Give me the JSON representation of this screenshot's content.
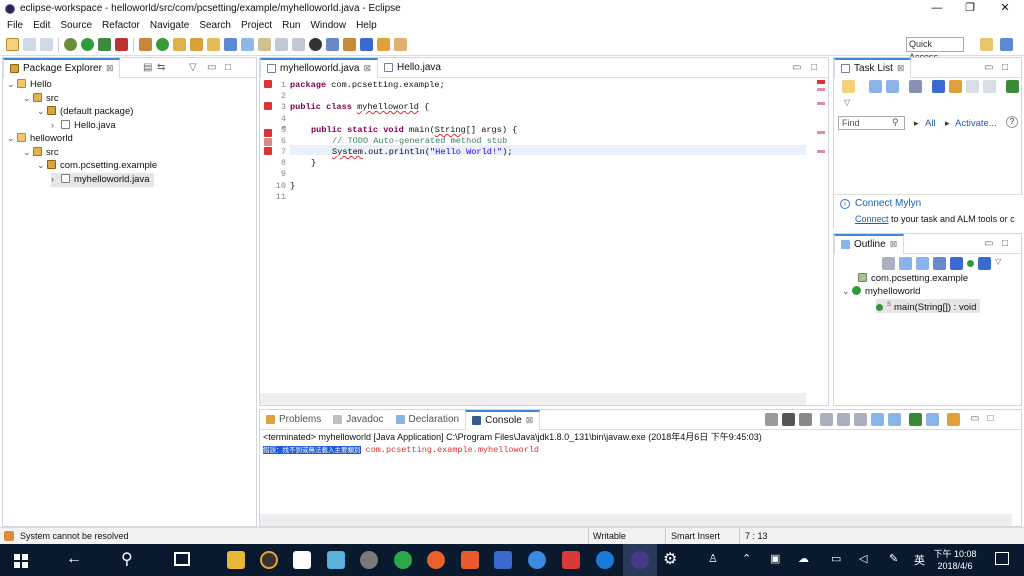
{
  "window": {
    "title": "eclipse-workspace - helloworld/src/com/pcsetting/example/myhelloworld.java - Eclipse",
    "min": "—",
    "max": "❐",
    "close": "✕"
  },
  "menu": [
    "File",
    "Edit",
    "Source",
    "Refactor",
    "Navigate",
    "Search",
    "Project",
    "Run",
    "Window",
    "Help"
  ],
  "toolbar": {
    "quick_access": "Quick Access"
  },
  "package_explorer": {
    "tab": "Package Explorer",
    "close": "⊠",
    "tree": [
      {
        "chev": "⌄",
        "label": "Hello"
      },
      {
        "chev": "⌄",
        "label": "src"
      },
      {
        "chev": "⌄",
        "label": "(default package)"
      },
      {
        "chev": "›",
        "label": "Hello.java"
      },
      {
        "chev": "⌄",
        "label": "helloworld"
      },
      {
        "chev": "⌄",
        "label": "src"
      },
      {
        "chev": "⌄",
        "label": "com.pcsetting.example"
      },
      {
        "chev": "›",
        "label": "myhelloworld.java"
      }
    ]
  },
  "editor": {
    "tabs": [
      {
        "label": "myhelloworld.java",
        "close": "⊠"
      },
      {
        "label": "Hello.java"
      }
    ],
    "line_numbers": [
      "1",
      "2",
      "3",
      "4",
      "5",
      "6",
      "7",
      "8",
      "9",
      "10",
      "11"
    ],
    "fold_marker": "⊖",
    "code": {
      "l1_kw": "package",
      "l1_rest": " com.pcsetting.example;",
      "l3_kw": "public class",
      "l3_name": "myhelloworld",
      "l3_rest": " {",
      "l5_kw": "public static void",
      "l5_rest1": " main(",
      "l5_type": "String",
      "l5_rest2": "[] args) {",
      "l6": "// TODO Auto-generated method stub",
      "l7_sys": "System",
      "l7_rest": ".out.println(",
      "l7_str": "\"Hello World!\"",
      "l7_end": ");",
      "l8": "}",
      "l10": "}"
    }
  },
  "task_list": {
    "tab": "Task List",
    "close": "⊠",
    "find_placeholder": "Find",
    "all": "All",
    "activate": "Activate...",
    "all_arrow": "▸",
    "activate_arrow": "▸",
    "help": "?"
  },
  "mylyn": {
    "title": "Connect Mylyn",
    "link": "Connect",
    "rest": " to your task and ALM tools or c"
  },
  "outline": {
    "tab": "Outline",
    "close": "⊠",
    "items": [
      {
        "label": "com.pcsetting.example"
      },
      {
        "label": "myhelloworld"
      },
      {
        "label": "main(String[]) : void",
        "sup": "S"
      }
    ]
  },
  "bottom": {
    "tabs": [
      {
        "label": "Problems"
      },
      {
        "label": "Javadoc"
      },
      {
        "label": "Declaration"
      },
      {
        "label": "Console",
        "close": "⊠"
      }
    ],
    "terminated": "<terminated> myhelloworld [Java Application] C:\\Program Files\\Java\\jdk1.8.0_131\\bin\\javaw.exe (2018年4月6日 下午9:45:03)",
    "error_highlight": "錯誤：找不到或無法載入主要類別",
    "error_class": " com.pcsetting.example.myhelloworld"
  },
  "status": {
    "message": "System cannot be resolved",
    "writable": "Writable",
    "insert": "Smart Insert",
    "position": "7 : 13"
  },
  "taskbar": {
    "time": "下午 10:08",
    "date": "2018/4/6",
    "lang": "英"
  },
  "colors": {
    "accent": "#3a8ad8",
    "error": "#e03030",
    "console_highlight": "#1e5bd8",
    "taskbar": "#0a1a2e"
  }
}
